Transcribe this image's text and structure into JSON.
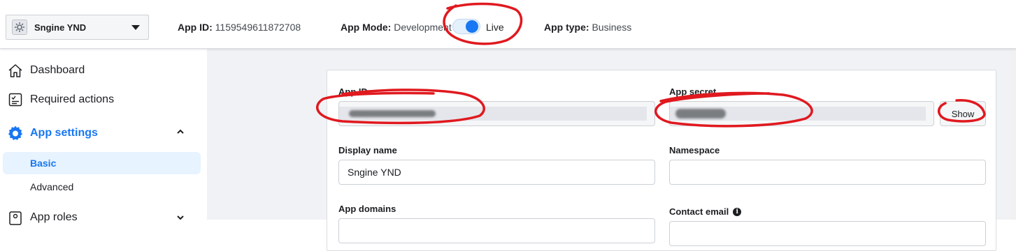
{
  "topbar": {
    "app_name": "Sngine YND",
    "app_id_label": "App ID:",
    "app_id_value": "1159549611872708",
    "app_mode_label": "App Mode:",
    "app_mode_value": "Development",
    "live_label": "Live",
    "live_enabled": true,
    "app_type_label": "App type:",
    "app_type_value": "Business"
  },
  "sidebar": {
    "dashboard": "Dashboard",
    "required_actions": "Required actions",
    "app_settings": "App settings",
    "basic": "Basic",
    "advanced": "Advanced",
    "app_roles": "App roles"
  },
  "form": {
    "app_id_label": "App ID",
    "app_secret_label": "App secret",
    "show_button": "Show",
    "display_name_label": "Display name",
    "display_name_value": "Sngine YND",
    "namespace_label": "Namespace",
    "namespace_value": "",
    "app_domains_label": "App domains",
    "contact_email_label": "Contact email"
  },
  "colors": {
    "accent": "#1877f2",
    "annotation": "#e0191f",
    "main_bg": "#f0f2f5"
  },
  "icons": [
    "settings-cog-icon",
    "caret-down-icon",
    "home-icon",
    "checklist-icon",
    "gear-icon",
    "chevron-up-icon",
    "chevron-down-icon",
    "roles-icon",
    "info-icon"
  ]
}
